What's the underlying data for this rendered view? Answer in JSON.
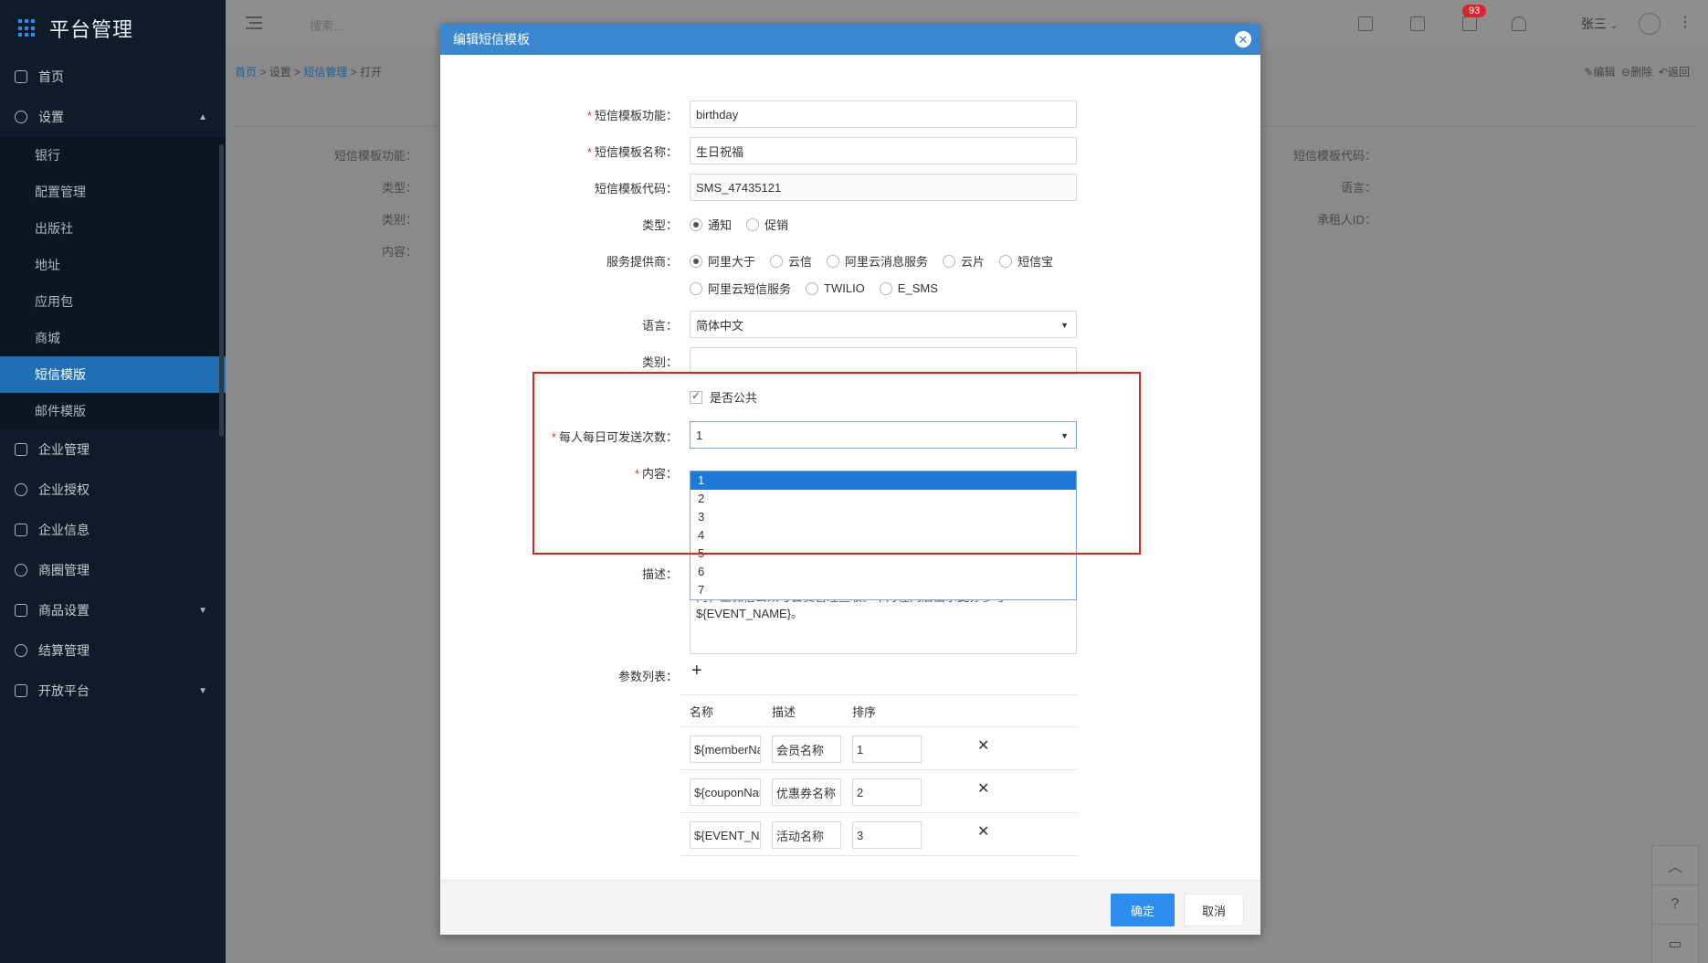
{
  "sidebar": {
    "brand": "平台管理",
    "items": [
      {
        "label": "首页",
        "icon": "home-icon"
      },
      {
        "label": "设置",
        "icon": "gear-icon",
        "expanded": true
      },
      {
        "label": "企业管理",
        "icon": "grid-icon"
      },
      {
        "label": "企业授权",
        "icon": "shield-icon"
      },
      {
        "label": "企业信息",
        "icon": "id-card-icon"
      },
      {
        "label": "商圈管理",
        "icon": "compass-icon"
      },
      {
        "label": "商品设置",
        "icon": "grid-icon"
      },
      {
        "label": "结算管理",
        "icon": "yen-icon"
      },
      {
        "label": "开放平台",
        "icon": "browser-icon"
      }
    ],
    "sub_items": [
      "银行",
      "配置管理",
      "出版社",
      "地址",
      "应用包",
      "商城",
      "短信模版",
      "邮件模版"
    ],
    "active_sub": "短信模版"
  },
  "topbar": {
    "search_placeholder": "搜索...",
    "badge_count": "93",
    "user_name": "张三"
  },
  "breadcrumb": [
    "首页",
    "设置",
    "短信管理",
    "打开"
  ],
  "page_actions": [
    "编辑",
    "删除",
    "返回"
  ],
  "bg_labels": {
    "left": [
      "短信模板功能：",
      "类型：",
      "类别：",
      "内容："
    ],
    "right": [
      "短信模板代码：",
      "语言：",
      "承租人ID："
    ]
  },
  "modal": {
    "title": "编辑短信模板",
    "fields": {
      "func_label": "短信模板功能：",
      "func_value": "birthday",
      "name_label": "短信模板名称：",
      "name_value": "生日祝福",
      "code_label": "短信模板代码：",
      "code_value": "SMS_47435121",
      "type_label": "类型：",
      "type_options": [
        "通知",
        "促销"
      ],
      "type_selected": "通知",
      "provider_label": "服务提供商：",
      "provider_options_row1": [
        "阿里大于",
        "云信",
        "阿里云消息服务",
        "云片",
        "短信宝"
      ],
      "provider_options_row2": [
        "阿里云短信服务",
        "TWILIO",
        "E_SMS"
      ],
      "provider_selected": "阿里大于",
      "lang_label": "语言：",
      "lang_value": "简体中文",
      "category_label": "类别：",
      "category_value": "",
      "public_label": "是否公共",
      "daily_label": "每人每日可发送次数：",
      "daily_value": "1",
      "daily_options": [
        "1",
        "2",
        "3",
        "4",
        "5",
        "6",
        "7"
      ],
      "content_label": "内容：",
      "desc_label": "描述：",
      "desc_line1": "内，王微信公众号会员管理查收。本月在门店出示此券参与",
      "desc_line2": "${EVENT_NAME}。",
      "params_label": "参数列表："
    },
    "param_table": {
      "headers": [
        "名称",
        "描述",
        "排序"
      ],
      "rows": [
        {
          "name": "${memberName}",
          "desc": "会员名称",
          "order": "1"
        },
        {
          "name": "${couponName}",
          "desc": "优惠券名称",
          "order": "2"
        },
        {
          "name": "${EVENT_NAME}",
          "desc": "活动名称",
          "order": "3"
        }
      ]
    },
    "ok_label": "确定",
    "cancel_label": "取消"
  }
}
